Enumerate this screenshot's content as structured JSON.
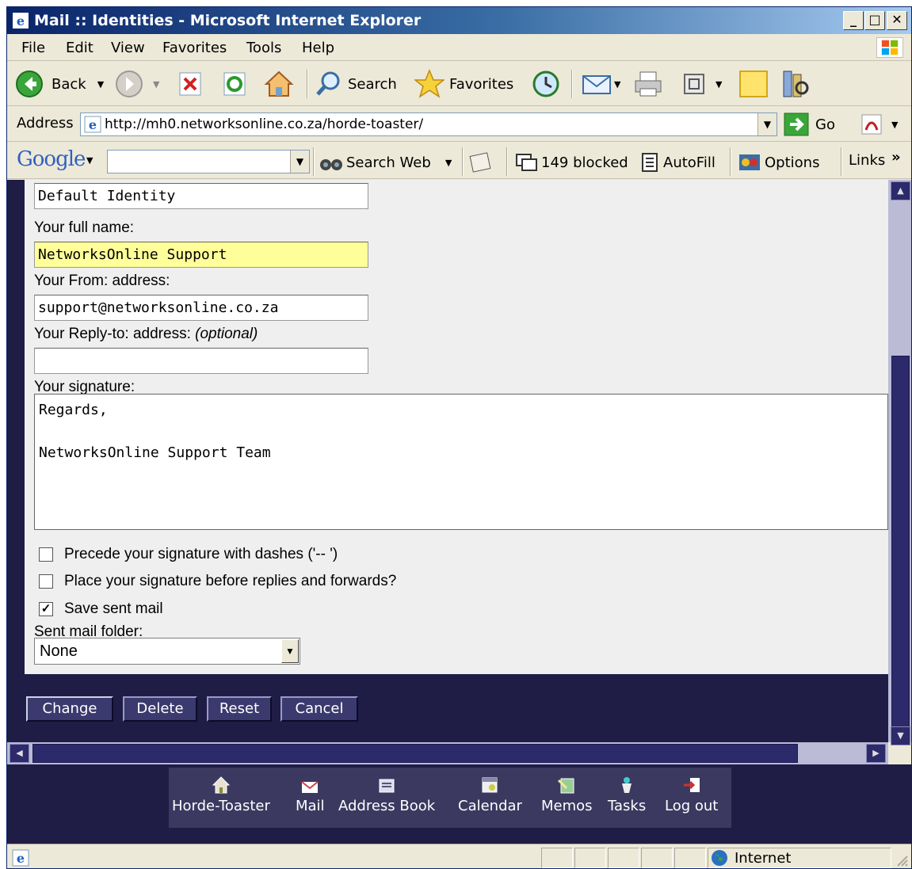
{
  "window": {
    "title": "Mail :: Identities - Microsoft Internet Explorer",
    "min": "_",
    "max": "□",
    "close": "✕"
  },
  "menu": [
    "File",
    "Edit",
    "View",
    "Favorites",
    "Tools",
    "Help"
  ],
  "toolbar": {
    "back": "Back",
    "search": "Search",
    "favorites": "Favorites"
  },
  "address": {
    "label": "Address",
    "url": "http://mh0.networksonline.co.za/horde-toaster/",
    "go": "Go"
  },
  "googlebar": {
    "logo": "Google",
    "search_web": "Search Web",
    "blocked": "149 blocked",
    "autofill": "AutoFill",
    "options": "Options",
    "links": "Links",
    "more": "»"
  },
  "form": {
    "identity_value": "Default Identity",
    "fullname_label": "Your full name:",
    "fullname_value": "NetworksOnline Support",
    "from_label": "Your From: address:",
    "from_value": "support@networksonline.co.za",
    "replyto_label": "Your Reply-to: address:",
    "replyto_optional": "(optional)",
    "replyto_value": "",
    "signature_label": "Your signature:",
    "signature_value": "Regards,\n\nNetworksOnline Support Team",
    "dashes_label": "Precede your signature with dashes ('-- ')",
    "dashes_checked": false,
    "before_label": "Place your signature before replies and forwards?",
    "before_checked": false,
    "save_label": "Save sent mail",
    "save_checked": true,
    "check_mark": "✓",
    "folder_label": "Sent mail folder:",
    "folder_value": "None"
  },
  "buttons": {
    "change": "Change",
    "delete": "Delete",
    "reset": "Reset",
    "cancel": "Cancel"
  },
  "nav": [
    {
      "label": "Horde-Toaster",
      "icon": "home-icon"
    },
    {
      "label": "Mail",
      "icon": "mail-icon"
    },
    {
      "label": "Address Book",
      "icon": "address-book-icon"
    },
    {
      "label": "Calendar",
      "icon": "calendar-icon"
    },
    {
      "label": "Memos",
      "icon": "memo-icon"
    },
    {
      "label": "Tasks",
      "icon": "tasks-icon"
    },
    {
      "label": "Log out",
      "icon": "logout-icon"
    }
  ],
  "status": {
    "zone": "Internet"
  },
  "colors": {
    "content_bg": "#1f1c46",
    "button_bg": "#3b3a6e",
    "highlight_input": "#ffff99",
    "titlebar": "#0a246a"
  }
}
